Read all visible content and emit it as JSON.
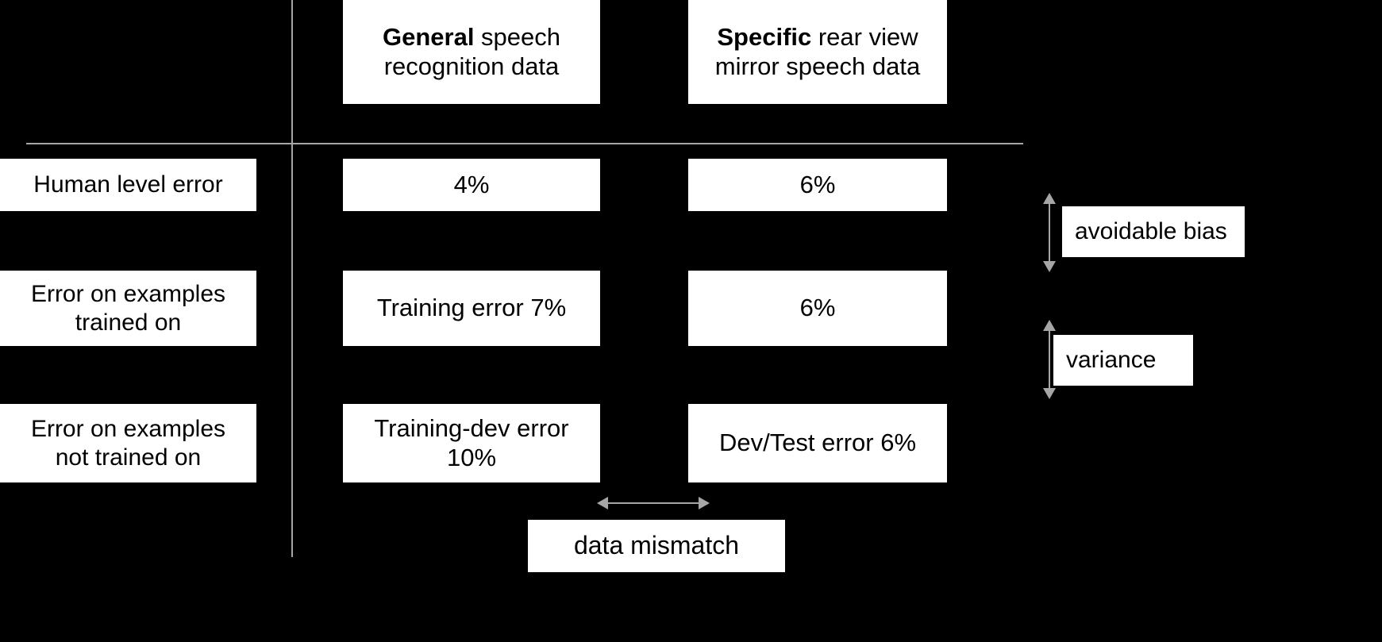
{
  "slide": {
    "background_color": "#000000",
    "box_color": "#ffffff",
    "text_color": "#000000",
    "rule_color": "#a6a6a6",
    "arrow_color": "#a6a6a6"
  },
  "columns": [
    {
      "id": "general",
      "header_bold": "General",
      "header_rest": " speech",
      "header_line2": "recognition data"
    },
    {
      "id": "specific",
      "header_bold": "Specific",
      "header_rest": " rear view",
      "header_line2": "mirror speech data"
    }
  ],
  "rows": [
    {
      "id": "human-level-error",
      "label": "Human level error",
      "general": "4%",
      "specific": "6%"
    },
    {
      "id": "error-trained-on",
      "label_line1": "Error on examples",
      "label_line2": "trained on",
      "general": "Training error 7%",
      "specific": "6%"
    },
    {
      "id": "error-not-trained-on",
      "label_line1": "Error on examples",
      "label_line2": "not trained on",
      "general_line1": "Training-dev error",
      "general_line2": "10%",
      "specific": "Dev/Test error 6%"
    }
  ],
  "annotations": {
    "avoidable_bias": "avoidable bias",
    "variance": "variance",
    "data_mismatch": "data mismatch"
  },
  "icons": {
    "avoidable_bias_arrow": "double-headed-vertical-arrow-icon",
    "variance_arrow": "double-headed-vertical-arrow-icon",
    "data_mismatch_arrow": "double-headed-horizontal-arrow-icon"
  }
}
